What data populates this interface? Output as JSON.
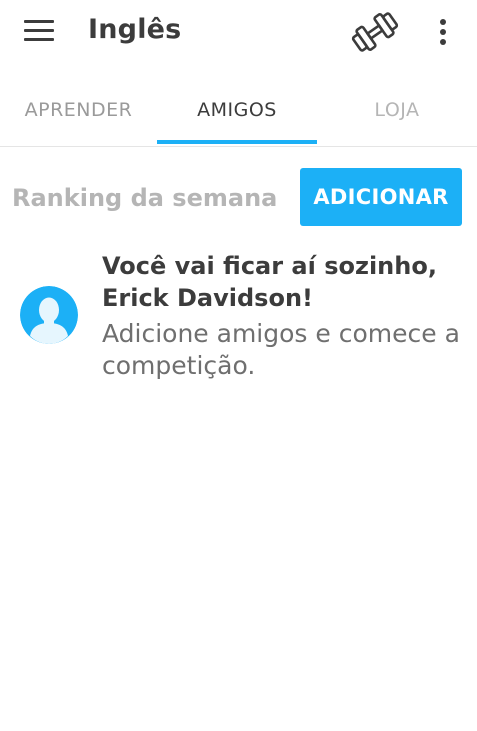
{
  "appbar": {
    "title": "Inglês",
    "icons": [
      "menu-icon",
      "dumbbell-icon",
      "more-vert-icon"
    ]
  },
  "tabs": [
    {
      "label": "APRENDER",
      "selected": false
    },
    {
      "label": "AMIGOS",
      "selected": true
    },
    {
      "label": "LOJA",
      "selected": false
    }
  ],
  "ranking": {
    "title": "Ranking da semana",
    "add_label": "ADICIONAR"
  },
  "empty_state": {
    "heading_line1": "Você vai ficar aí sozinho,",
    "heading_line2": "Erick Davidson!",
    "body_line1": "Adicione amigos e comece a",
    "body_line2": "competição."
  },
  "colors": {
    "accent": "#1cb0f6",
    "text_dark": "#3c3c3c",
    "text_muted": "#b5b5b5"
  }
}
